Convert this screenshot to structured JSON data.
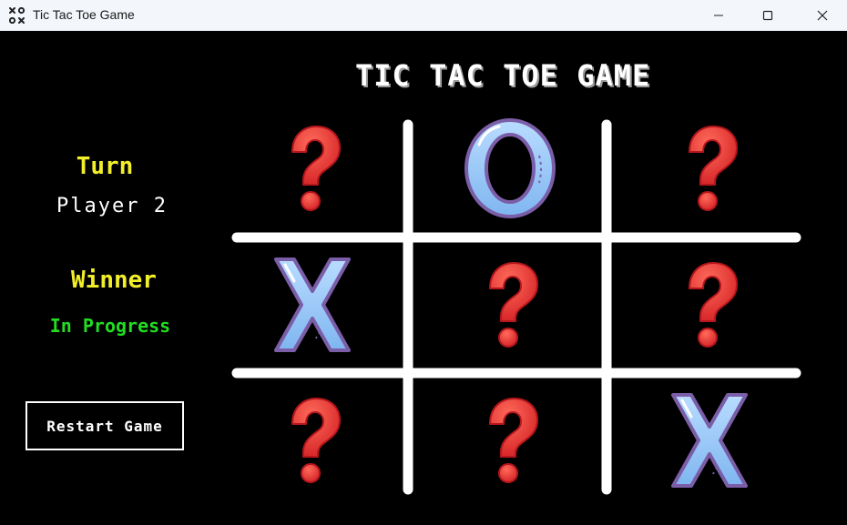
{
  "window": {
    "title": "Tic Tac Toe Game"
  },
  "game": {
    "title": "TIC TAC TOE GAME",
    "turn_label": "Turn",
    "turn_value": "Player 2",
    "winner_label": "Winner",
    "winner_value": "In Progress",
    "restart_label": "Restart Game"
  },
  "board": [
    [
      "?",
      "O",
      "?"
    ],
    [
      "X",
      "?",
      "?"
    ],
    [
      "?",
      "?",
      "X"
    ]
  ],
  "colors": {
    "background": "#000000",
    "turn_label": "#f2ef2a",
    "winner_label": "#f2ef2a",
    "winner_value": "#22dd22",
    "text": "#ffffff",
    "grid": "#ffffff",
    "question_mark": "#e22a2a",
    "mark_fill": "#8fc3f5",
    "mark_stroke": "#7b5ea8"
  }
}
